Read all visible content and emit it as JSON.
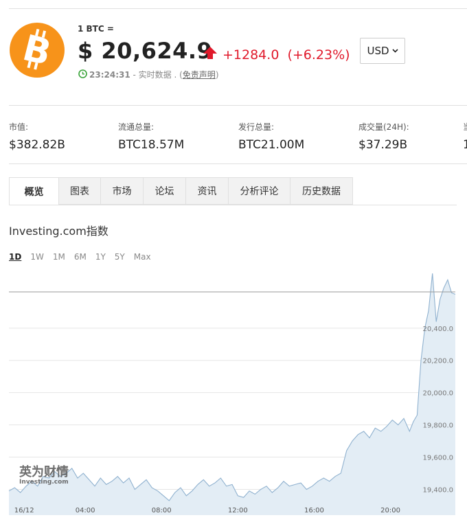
{
  "header": {
    "unit_label": "1 BTC =",
    "price": "$ 20,624.9",
    "change": "+1284.0",
    "change_pct": "(+6.23%)",
    "time": "23:24:31",
    "status_text": " - 实时数据 . (",
    "disclaimer_link": "免责声明",
    "status_close": ")",
    "currency": "USD",
    "logo_symbol": "bitcoin-logo",
    "up_color": "#e0192b",
    "brand_color": "#f7931a"
  },
  "stats": [
    {
      "label": "市值:",
      "value": "$382.82B"
    },
    {
      "label": "流通总量:",
      "value": "BTC18.57M"
    },
    {
      "label": "发行总量:",
      "value": "BTC21.00M"
    },
    {
      "label": "成交量(24H):",
      "value": "$37.29B"
    },
    {
      "label": "当",
      "value": "1"
    }
  ],
  "tabs": [
    "概览",
    "图表",
    "市场",
    "论坛",
    "资讯",
    "分析评论",
    "历史数据"
  ],
  "chart": {
    "title": "Investing.com指数",
    "ranges": [
      "1D",
      "1W",
      "1M",
      "6M",
      "1Y",
      "5Y",
      "Max"
    ],
    "active_range": "1D",
    "watermark_cn": "英为财情",
    "watermark_en": "Investing.com"
  },
  "chart_data": {
    "type": "area",
    "x_labels": [
      "16/12",
      "04:00",
      "08:00",
      "12:00",
      "16:00",
      "20:00"
    ],
    "y_ticks": [
      19400,
      19600,
      19800,
      20000,
      20200,
      20400
    ],
    "y_tick_labels": [
      "19,400.0",
      "19,600.0",
      "19,800.0",
      "20,000.0",
      "20,200.0",
      "20,400.0"
    ],
    "ylim": [
      19240,
      20740
    ],
    "xlim": [
      0,
      23.4
    ],
    "reference_level": 20624.9,
    "series": [
      {
        "x": [
          0,
          0.3,
          0.6,
          0.9,
          1.2,
          1.5,
          1.8,
          2.1,
          2.4,
          2.7,
          3.0,
          3.3,
          3.6,
          3.9,
          4.2,
          4.5,
          4.8,
          5.1,
          5.4,
          5.7,
          6.0,
          6.3,
          6.6,
          6.9,
          7.2,
          7.5,
          7.8,
          8.1,
          8.4,
          8.7,
          9.0,
          9.3,
          9.6,
          9.9,
          10.2,
          10.5,
          10.8,
          11.1,
          11.4,
          11.7,
          12.0,
          12.3,
          12.6,
          12.9,
          13.2,
          13.5,
          13.8,
          14.1,
          14.4,
          14.7,
          15.0,
          15.3,
          15.6,
          15.9,
          16.2,
          16.5,
          16.8,
          17.1,
          17.4,
          17.7,
          18.0,
          18.3,
          18.6,
          18.9,
          19.2,
          19.5,
          19.8,
          20.1,
          20.4,
          20.7,
          21.0,
          21.2,
          21.4,
          21.6,
          21.8,
          22.0,
          22.2,
          22.4,
          22.6,
          22.8,
          23.0,
          23.2,
          23.4
        ],
        "y": [
          19390,
          19410,
          19380,
          19420,
          19450,
          19420,
          19480,
          19470,
          19510,
          19480,
          19500,
          19530,
          19470,
          19500,
          19460,
          19420,
          19470,
          19430,
          19450,
          19480,
          19440,
          19470,
          19400,
          19430,
          19460,
          19410,
          19390,
          19360,
          19330,
          19380,
          19410,
          19360,
          19390,
          19430,
          19460,
          19420,
          19440,
          19470,
          19420,
          19430,
          19360,
          19350,
          19390,
          19370,
          19400,
          19420,
          19380,
          19410,
          19450,
          19420,
          19430,
          19440,
          19400,
          19420,
          19450,
          19470,
          19450,
          19480,
          19500,
          19640,
          19700,
          19740,
          19760,
          19720,
          19780,
          19760,
          19790,
          19830,
          19800,
          19840,
          19760,
          19820,
          19860,
          20200,
          20400,
          20510,
          20740,
          20440,
          20580,
          20650,
          20700,
          20620,
          20610
        ]
      }
    ]
  }
}
